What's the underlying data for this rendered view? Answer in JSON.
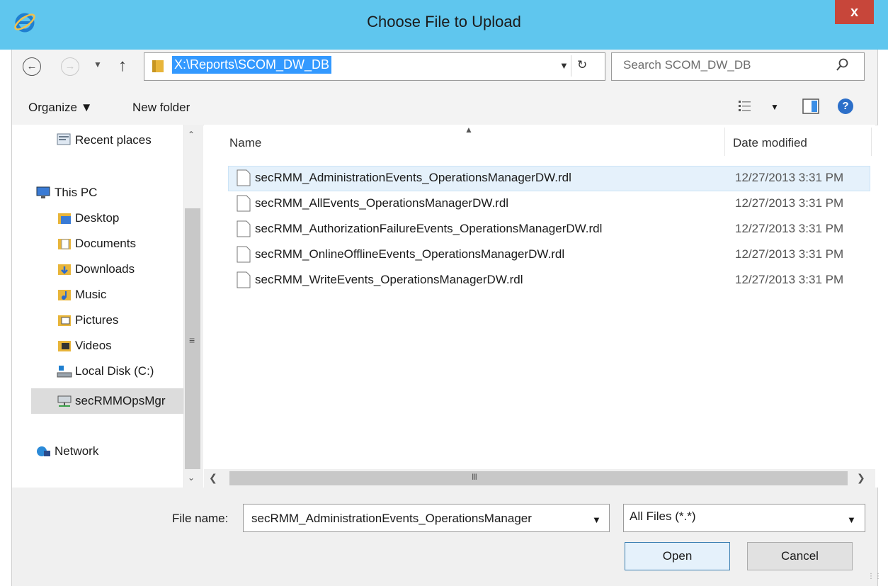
{
  "window": {
    "title": "Choose File to Upload",
    "close_glyph": "x"
  },
  "address": {
    "path": "X:\\Reports\\SCOM_DW_DB",
    "search_placeholder": "Search SCOM_DW_DB"
  },
  "toolbar": {
    "organize_label": "Organize ▼",
    "new_folder_label": "New folder"
  },
  "nav": {
    "items": [
      {
        "label": "Recent places",
        "icon": "recent-places-icon"
      },
      {
        "label": "This PC",
        "icon": "computer-icon"
      },
      {
        "label": "Desktop",
        "icon": "desktop-folder-icon"
      },
      {
        "label": "Documents",
        "icon": "documents-folder-icon"
      },
      {
        "label": "Downloads",
        "icon": "downloads-folder-icon"
      },
      {
        "label": "Music",
        "icon": "music-folder-icon"
      },
      {
        "label": "Pictures",
        "icon": "pictures-folder-icon"
      },
      {
        "label": "Videos",
        "icon": "videos-folder-icon"
      },
      {
        "label": "Local Disk (C:)",
        "icon": "local-disk-icon"
      },
      {
        "label": "secRMMOpsMgr",
        "icon": "network-drive-icon"
      },
      {
        "label": "Network",
        "icon": "network-icon"
      }
    ],
    "scrollbar_grip": "≡"
  },
  "list": {
    "columns": {
      "name": "Name",
      "date": "Date modified"
    },
    "files": [
      {
        "name": "secRMM_AdministrationEvents_OperationsManagerDW.rdl",
        "date": "12/27/2013 3:31 PM"
      },
      {
        "name": "secRMM_AllEvents_OperationsManagerDW.rdl",
        "date": "12/27/2013 3:31 PM"
      },
      {
        "name": "secRMM_AuthorizationFailureEvents_OperationsManagerDW.rdl",
        "date": "12/27/2013 3:31 PM"
      },
      {
        "name": "secRMM_OnlineOfflineEvents_OperationsManagerDW.rdl",
        "date": "12/27/2013 3:31 PM"
      },
      {
        "name": "secRMM_WriteEvents_OperationsManagerDW.rdl",
        "date": "12/27/2013 3:31 PM"
      }
    ],
    "hscroll_grip": "III"
  },
  "bottom": {
    "filename_label": "File name:",
    "filename_value": "secRMM_AdministrationEvents_OperationsManager",
    "filetype_value": "All Files (*.*)",
    "open_label": "Open",
    "cancel_label": "Cancel"
  },
  "colors": {
    "titlebar": "#5fc6ee",
    "close": "#c7463a",
    "selection": "#3399ff",
    "row_selected": "#e5f1fb"
  }
}
